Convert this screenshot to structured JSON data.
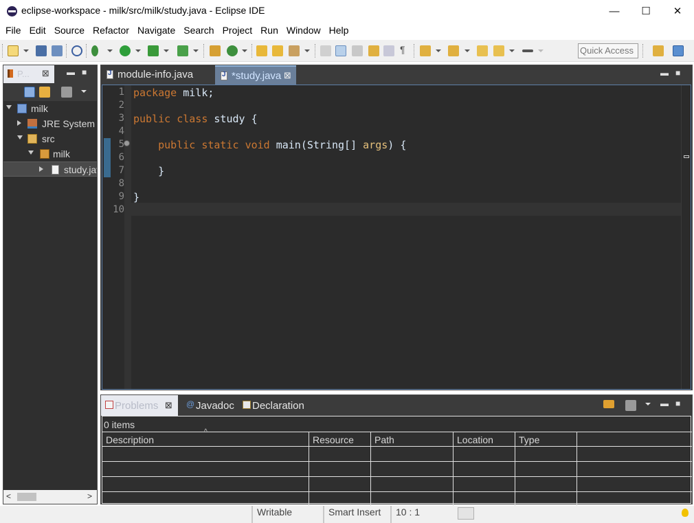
{
  "window": {
    "title": "eclipse-workspace - milk/src/milk/study.java - Eclipse IDE",
    "minimize": "—",
    "maximize": "☐",
    "close": "✕"
  },
  "menu": [
    "File",
    "Edit",
    "Source",
    "Refactor",
    "Navigate",
    "Search",
    "Project",
    "Run",
    "Window",
    "Help"
  ],
  "toolbar": {
    "quick_access_placeholder": "Quick Access"
  },
  "package_explorer": {
    "tab_label": "P...",
    "tree": [
      {
        "label": "milk",
        "icon": "project-icon",
        "expanded": true
      },
      {
        "label": "JRE System Library",
        "icon": "library-icon",
        "expanded": false
      },
      {
        "label": "src",
        "icon": "source-folder-icon",
        "expanded": true
      },
      {
        "label": "milk",
        "icon": "package-icon",
        "expanded": true
      },
      {
        "label": "study.java",
        "icon": "java-file-icon",
        "expanded": false,
        "selected": true
      }
    ]
  },
  "editor": {
    "tabs": [
      {
        "label": "module-info.java",
        "active": false
      },
      {
        "label": "*study.java",
        "active": true
      }
    ],
    "line_numbers": [
      "1",
      "2",
      "3",
      "4",
      "5",
      "6",
      "7",
      "8",
      "9",
      "10"
    ],
    "code": {
      "l1_kw": "package",
      "l1_rest": " milk;",
      "l3_kw1": "public",
      "l3_kw2": "class",
      "l3_rest": " study {",
      "l5_indent": "    ",
      "l5_kw1": "public",
      "l5_kw2": "static",
      "l5_kw3": "void",
      "l5_rest": " main(String[] ",
      "l5_param": "args",
      "l5_end": ") {",
      "l7": "    }",
      "l9": "}"
    }
  },
  "bottom_panel": {
    "tabs": [
      {
        "label": "Problems",
        "active": true
      },
      {
        "label": "Javadoc",
        "active": false
      },
      {
        "label": "Declaration",
        "active": false
      }
    ],
    "items_count": "0 items",
    "columns": [
      "Description",
      "Resource",
      "Path",
      "Location",
      "Type"
    ]
  },
  "status": {
    "writable": "Writable",
    "insert_mode": "Smart Insert",
    "cursor_position": "10 : 1"
  },
  "colors": {
    "editor_bg": "#2b2b2b",
    "keyword": "#cc7832",
    "text": "#d9e8f7",
    "param": "#e5c07b",
    "active_tab": "#6a7f9a"
  }
}
